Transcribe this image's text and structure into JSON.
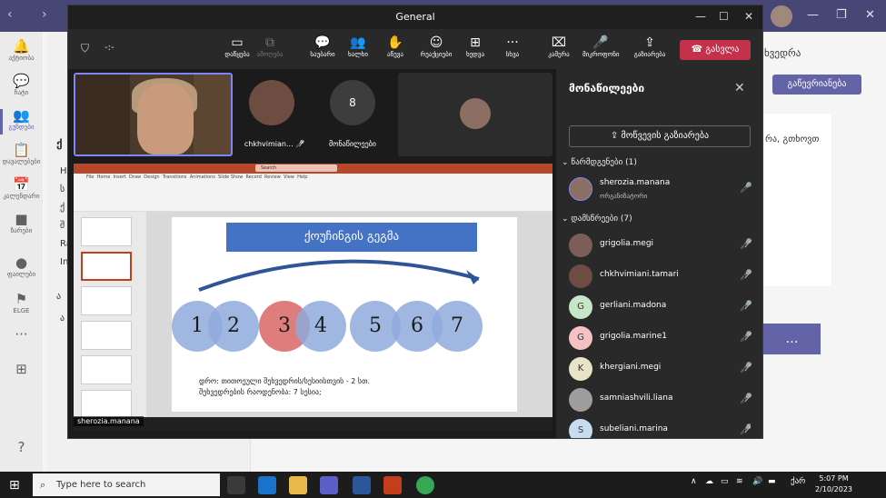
{
  "teams": {
    "rail_items": [
      "აქტიობა",
      "ჩატი",
      "გუნდები",
      "დავალებები",
      "კალენდარი",
      "ზარები",
      "ფაილები",
      "ELGE"
    ],
    "join_button": "გაწევრიანება",
    "bg_fragment_1": "ხვედრა",
    "bg_fragment_2": "რა, გთხოვთ",
    "bg_more": "…",
    "bg_left_frags": [
      "ქ",
      "H",
      "ს",
      "ქ",
      "შ",
      "Ra",
      "In",
      "ა",
      "ა"
    ]
  },
  "meeting": {
    "window_title": "General",
    "timer": "-:-",
    "toolbar": [
      {
        "icon": "share-icon",
        "label": "დაწყება",
        "dim": false
      },
      {
        "icon": "popout-icon",
        "label": "ამოღება",
        "dim": true
      },
      {
        "icon": "chat-icon",
        "label": "საუბარი",
        "dim": false
      },
      {
        "icon": "people-icon",
        "label": "ხალხი",
        "dim": false
      },
      {
        "icon": "raise-hand-icon",
        "label": "აწევა",
        "dim": false
      },
      {
        "icon": "reactions-icon",
        "label": "რეაქციები",
        "dim": false
      },
      {
        "icon": "view-icon",
        "label": "ხედვა",
        "dim": false
      },
      {
        "icon": "more-icon",
        "label": "სხვა",
        "dim": false
      },
      {
        "icon": "camera-off-icon",
        "label": "კამერა",
        "dim": false
      },
      {
        "icon": "mic-off-icon",
        "label": "მიკროფონი",
        "dim": false
      },
      {
        "icon": "share-screen-icon",
        "label": "გაზიარება",
        "dim": false
      }
    ],
    "leave_button": "გასვლა",
    "tiles": {
      "participant_name": "chkhvimian...",
      "others_count": "8",
      "others_label": "მონაწილეები"
    },
    "presenter_tag": "sherozia.manana",
    "slide": {
      "title": "ქოუჩინგის გეგმა",
      "circles": [
        "1",
        "2",
        "3",
        "4",
        "5",
        "6",
        "7"
      ],
      "note_1": "დრო:   თითოეული შეხვედრის/სესიისთვის - 2 სთ.",
      "note_2": "შეხვედრების რაოდენობა:    7 სესია;"
    },
    "ppt_tabs": [
      "File",
      "Home",
      "Insert",
      "Draw",
      "Design",
      "Transitions",
      "Animations",
      "Slide Show",
      "Record",
      "Review",
      "View",
      "Help"
    ],
    "ppt_search": "Search"
  },
  "panel": {
    "title": "მონაწილეები",
    "share_invite": "მოწვევის გაზიარება",
    "presenters_header": "წარმდგენები (1)",
    "attendees_header": "დამსწრეები (7)",
    "presenters": [
      {
        "name": "sherozia.manana",
        "role": "ორგანიზატორი",
        "initial": "",
        "color": "#8d6e63"
      }
    ],
    "attendees": [
      {
        "name": "grigolia.megi",
        "initial": "",
        "color": "#7b5e57"
      },
      {
        "name": "chkhvimiani.tamari",
        "initial": "",
        "color": "#6d4c41"
      },
      {
        "name": "gerliani.madona",
        "initial": "G",
        "color": "#c7e6c7"
      },
      {
        "name": "grigolia.marine1",
        "initial": "G",
        "color": "#f4c2c2"
      },
      {
        "name": "khergiani.megi",
        "initial": "K",
        "color": "#e8e3c8"
      },
      {
        "name": "samniashvili.liana",
        "initial": "",
        "color": "#9e9e9e"
      },
      {
        "name": "subeliani.marina",
        "initial": "S",
        "color": "#c8dcf0"
      }
    ]
  },
  "windows": {
    "search_placeholder": "Type here to search",
    "time": "5:07 PM",
    "date": "2/10/2023",
    "lang": "ქარ"
  }
}
